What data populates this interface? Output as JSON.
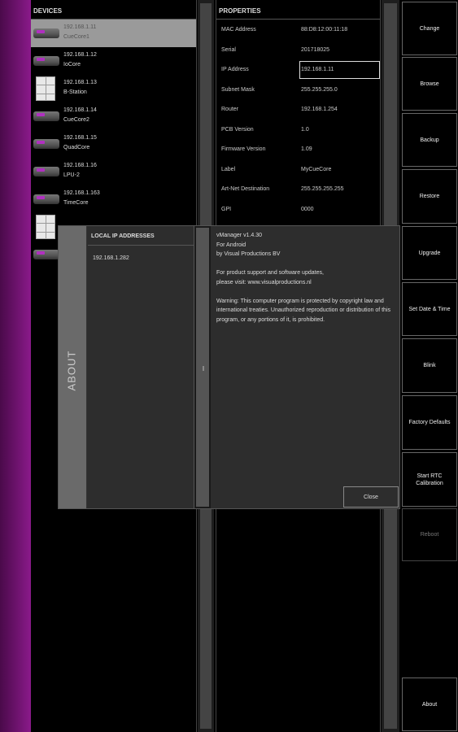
{
  "devices": {
    "header": "DEVICES",
    "items": [
      {
        "ip": "192.168.1.11",
        "name": "CueCore1",
        "icon": "cuecore-device-icon",
        "kind": "core",
        "selected": true
      },
      {
        "ip": "192.168.1.12",
        "name": "IoCore",
        "icon": "iocore-device-icon",
        "kind": "core",
        "selected": false
      },
      {
        "ip": "192.168.1.13",
        "name": "B-Station",
        "icon": "bstation-device-icon",
        "kind": "station",
        "selected": false
      },
      {
        "ip": "192.168.1.14",
        "name": "CueCore2",
        "icon": "cuecore-device-icon",
        "kind": "core",
        "selected": false
      },
      {
        "ip": "192.168.1.15",
        "name": "QuadCore",
        "icon": "quadcore-device-icon",
        "kind": "core",
        "selected": false
      },
      {
        "ip": "192.168.1.16",
        "name": "LPU-2",
        "icon": "lpu-device-icon",
        "kind": "core",
        "selected": false
      },
      {
        "ip": "192.168.1.163",
        "name": "TimeCore",
        "icon": "timecore-device-icon",
        "kind": "core",
        "selected": false
      },
      {
        "ip": "",
        "name": "",
        "icon": "station-device-icon",
        "kind": "station",
        "selected": false
      },
      {
        "ip": "",
        "name": "",
        "icon": "core-device-icon",
        "kind": "core",
        "selected": false
      }
    ]
  },
  "properties": {
    "header": "PROPERTIES",
    "rows": [
      {
        "key": "MAC Address",
        "value": "88:D8:12:00:11:18"
      },
      {
        "key": "Serial",
        "value": "201718025"
      },
      {
        "key": "IP Address",
        "value": "192.168.1.11",
        "editable": true
      },
      {
        "key": "Subnet Mask",
        "value": "255.255.255.0"
      },
      {
        "key": "Router",
        "value": "192.168.1.254"
      },
      {
        "key": "PCB Version",
        "value": "1.0"
      },
      {
        "key": "Firmware Version",
        "value": "1.09"
      },
      {
        "key": "Label",
        "value": "MyCueCore"
      },
      {
        "key": "Art-Net Destination",
        "value": "255.255.255.255"
      },
      {
        "key": "GPI",
        "value": "0000"
      }
    ]
  },
  "buttons": [
    {
      "label": "Change",
      "enabled": true
    },
    {
      "label": "Browse",
      "enabled": true
    },
    {
      "label": "Backup",
      "enabled": true
    },
    {
      "label": "Restore",
      "enabled": true
    },
    {
      "label": "Upgrade",
      "enabled": true
    },
    {
      "label": "Set Date & Time",
      "enabled": true
    },
    {
      "label": "Blink",
      "enabled": true
    },
    {
      "label": "Factory Defaults",
      "enabled": true
    },
    {
      "label": "Start RTC Calibration",
      "enabled": true
    },
    {
      "label": "Reboot",
      "enabled": false
    },
    {
      "label": "About",
      "enabled": true
    }
  ],
  "about": {
    "tab_label": "ABOUT",
    "ip_header": "LOCAL IP ADDRESSES",
    "ip_items": [
      "192.168.1.282"
    ],
    "text": {
      "app_version": "vManager v1.4.30",
      "platform": "For Android",
      "company": "by Visual Productions BV",
      "support_1": "For product support and software updates,",
      "support_2": "please visit: www.visualproductions.nl",
      "warning": "Warning: This computer program is protected by copyright law and international treaties. Unauthorized reproduction or distribution of this program, or any portions of it, is prohibited."
    },
    "close_label": "Close"
  },
  "colors": {
    "accent": "#9a1a9a",
    "selected_row": "#9a9a9a",
    "dialog_bg": "#2d2d2d"
  }
}
